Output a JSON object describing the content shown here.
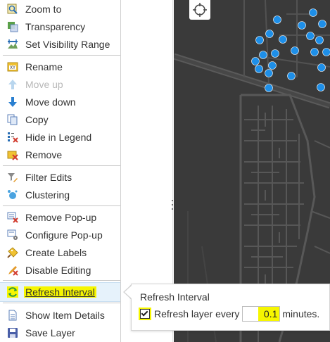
{
  "menu": {
    "items": [
      {
        "label": "Zoom to",
        "icon": "zoom-to-icon",
        "disabled": false
      },
      {
        "label": "Transparency",
        "icon": "transparency-icon",
        "disabled": false
      },
      {
        "label": "Set Visibility Range",
        "icon": "visibility-range-icon",
        "disabled": false
      },
      {
        "label": "Rename",
        "icon": "rename-icon",
        "disabled": false
      },
      {
        "label": "Move up",
        "icon": "arrow-up-icon",
        "disabled": true
      },
      {
        "label": "Move down",
        "icon": "arrow-down-icon",
        "disabled": false
      },
      {
        "label": "Copy",
        "icon": "copy-icon",
        "disabled": false
      },
      {
        "label": "Hide in Legend",
        "icon": "hide-in-legend-icon",
        "disabled": false
      },
      {
        "label": "Remove",
        "icon": "remove-icon",
        "disabled": false
      },
      {
        "label": "Filter Edits",
        "icon": "filter-edits-icon",
        "disabled": false
      },
      {
        "label": "Clustering",
        "icon": "clustering-icon",
        "disabled": false
      },
      {
        "label": "Remove Pop-up",
        "icon": "remove-popup-icon",
        "disabled": false
      },
      {
        "label": "Configure Pop-up",
        "icon": "configure-popup-icon",
        "disabled": false
      },
      {
        "label": "Create Labels",
        "icon": "create-labels-icon",
        "disabled": false
      },
      {
        "label": "Disable Editing",
        "icon": "disable-editing-icon",
        "disabled": false
      },
      {
        "label": "Refresh Interval",
        "icon": "refresh-icon",
        "disabled": false,
        "active": true
      },
      {
        "label": "Show Item Details",
        "icon": "item-details-icon",
        "disabled": false
      },
      {
        "label": "Save Layer",
        "icon": "save-icon",
        "disabled": false
      }
    ]
  },
  "popup": {
    "title": "Refresh Interval",
    "checkbox_label": "Refresh layer every",
    "checked": true,
    "interval_value": "0.1",
    "unit": "minutes."
  },
  "colors": {
    "highlight": "#f6f600",
    "map_background": "#3a3a3a",
    "point_color": "#1e8fe8",
    "active_row": "#e6f2fb"
  }
}
